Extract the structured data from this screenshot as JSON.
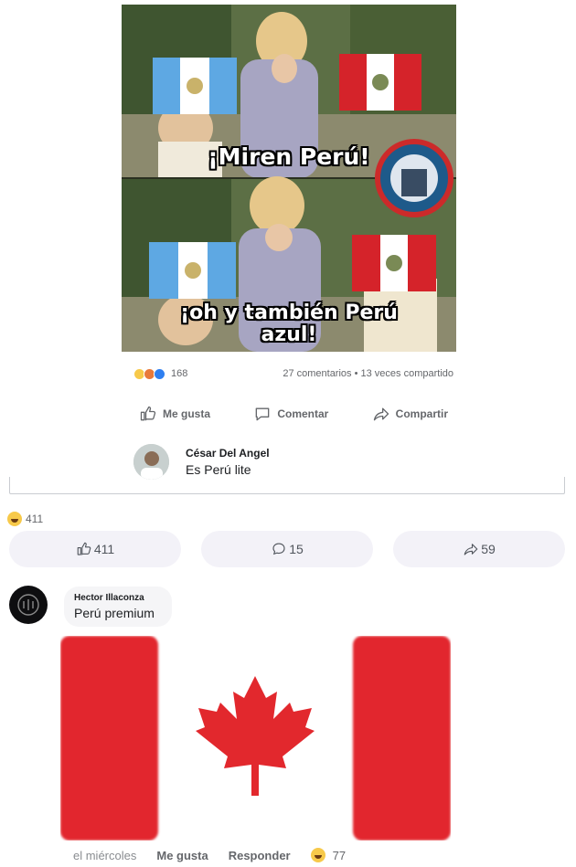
{
  "meme": {
    "caption_top": "¡Miren Perú!",
    "caption_bottom": "¡oh y también Perú azul!"
  },
  "embedded_post": {
    "reaction_count": "168",
    "meta": "27 comentarios • 13 veces compartido",
    "actions": {
      "like": "Me gusta",
      "comment": "Comentar",
      "share": "Compartir"
    },
    "comment": {
      "author": "César Del Angel",
      "text": "Es Perú lite"
    }
  },
  "post_stats": {
    "reactions": "411",
    "likes": "411",
    "comments": "15",
    "shares": "59"
  },
  "comment": {
    "author": "Hector Illaconza",
    "text": "Perú premium",
    "time": "el miércoles",
    "like_label": "Me gusta",
    "reply_label": "Responder",
    "reaction_count": "77"
  },
  "colors": {
    "canada_red": "#e2282d",
    "peru_red": "#d5232a",
    "guatemala_blue": "#5ea8e3",
    "muted_text": "#65676b",
    "pill_bg": "#f3f2f8"
  }
}
